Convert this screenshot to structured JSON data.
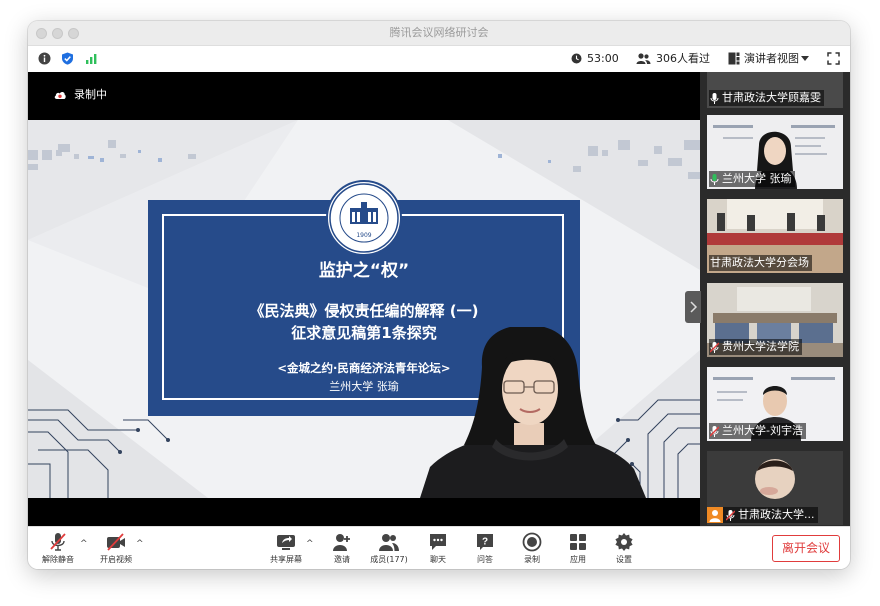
{
  "window": {
    "title": "腾讯会议网络研讨会"
  },
  "infobar": {
    "timer": "53:00",
    "viewers": "306人看过",
    "view_mode": "演讲者视图"
  },
  "recording": {
    "label": "录制中"
  },
  "slide": {
    "title": "监护之“权”",
    "subtitle_line1": "《民法典》侵权责任编的解释 (一)",
    "subtitle_line2": "征求意见稿第1条探究",
    "forum": "<金城之约·民商经济法青年论坛>",
    "presenter": "兰州大学 张瑜",
    "logo_year": "1909"
  },
  "participants": [
    {
      "name": "甘肃政法大学顾嘉雯",
      "active": false
    },
    {
      "name": "兰州大学 张瑜",
      "active": true
    },
    {
      "name": "甘肃政法大学分会场",
      "active": false
    },
    {
      "name": "贵州大学法学院",
      "active": false
    },
    {
      "name": "兰州大学-刘宇浩",
      "active": false
    },
    {
      "name": "甘肃政法大学...",
      "active": false
    }
  ],
  "toolbar": {
    "unmute": "解除静音",
    "start_video": "开启视频",
    "share": "共享屏幕",
    "invite": "邀请",
    "members": "成员(177)",
    "chat": "聊天",
    "qa": "问答",
    "record": "录制",
    "apps": "应用",
    "settings": "设置",
    "leave": "离开会议"
  },
  "colors": {
    "accent_blue": "#264b8a",
    "leave_red": "#e03c3c",
    "active_green": "#2fbf5b"
  }
}
